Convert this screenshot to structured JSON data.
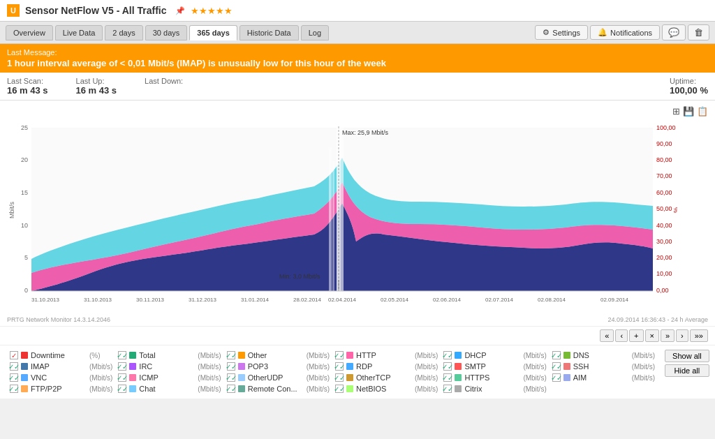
{
  "titleBar": {
    "icon": "U",
    "title": "Sensor NetFlow V5 - All Traffic",
    "stars": "★★★★★"
  },
  "navTabs": [
    {
      "label": "Overview",
      "active": false
    },
    {
      "label": "Live Data",
      "active": false
    },
    {
      "label": "2 days",
      "active": false
    },
    {
      "label": "30 days",
      "active": false
    },
    {
      "label": "365 days",
      "active": true
    },
    {
      "label": "Historic Data",
      "active": false
    },
    {
      "label": "Log",
      "active": false
    }
  ],
  "navActions": [
    {
      "label": "Settings",
      "icon": "⚙"
    },
    {
      "label": "Notifications",
      "icon": "🔔"
    }
  ],
  "alert": {
    "title": "Last Message:",
    "message": "1 hour interval average of < 0,01 Mbit/s (IMAP) is unusually low for this hour of the week"
  },
  "stats": [
    {
      "label": "Last Scan:",
      "value": "16 m 43 s"
    },
    {
      "label": "Last Up:",
      "value": "16 m 43 s"
    },
    {
      "label": "Last Down:",
      "value": ""
    },
    {
      "label": "Uptime:",
      "value": "100,00 %"
    }
  ],
  "chart": {
    "maxLabel": "Max: 25,9 Mbit/s",
    "minLabel": "Min: 3,0 Mbit/s",
    "leftAxis": [
      "25",
      "20",
      "15",
      "10",
      "5",
      "0"
    ],
    "leftAxisLabel": "Mbit/s",
    "rightAxis": [
      "100,00",
      "90,00",
      "80,00",
      "70,00",
      "60,00",
      "50,00",
      "40,00",
      "30,00",
      "20,00",
      "10,00",
      "0,00"
    ],
    "rightAxisLabel": "%",
    "xLabels": [
      "31.10.2013",
      "31.10.2013",
      "30.11.2013",
      "31.12.2013",
      "31.01.2014",
      "28.02.2014",
      "02.04.2014",
      "02.05.2014",
      "02.06.2014",
      "02.07.2014",
      "02.08.2014",
      "02.09.2014"
    ],
    "footerLeft": "PRTG Network Monitor 14.3.14.2046",
    "footerRight": "24.09.2014 16:36:43 - 24 h Average"
  },
  "navArrows": [
    "«",
    "‹",
    "+",
    "×",
    "»",
    "›",
    "»»"
  ],
  "legend": {
    "columns": [
      [
        {
          "checked": true,
          "checkColor": "red",
          "dot": "#e33",
          "name": "Downtime",
          "unit": "(%)"
        },
        {
          "checked": true,
          "checkColor": "blue",
          "dot": "#47a",
          "name": "IMAP",
          "unit": "(Mbit/s)"
        },
        {
          "checked": true,
          "checkColor": "blue",
          "dot": "#5af",
          "name": "VNC",
          "unit": "(Mbit/s)"
        },
        {
          "checked": true,
          "checkColor": "blue",
          "dot": "#fa5",
          "name": "FTP/P2P",
          "unit": "(Mbit/s)"
        }
      ],
      [
        {
          "checked": true,
          "checkColor": "blue",
          "dot": "#2a7",
          "name": "Total",
          "unit": "(Mbit/s)"
        },
        {
          "checked": true,
          "checkColor": "blue",
          "dot": "#a5f",
          "name": "IRC",
          "unit": "(Mbit/s)"
        },
        {
          "checked": true,
          "checkColor": "blue",
          "dot": "#f7a",
          "name": "ICMP",
          "unit": "(Mbit/s)"
        },
        {
          "checked": true,
          "checkColor": "blue",
          "dot": "#7cf",
          "name": "Chat",
          "unit": "(Mbit/s)"
        }
      ],
      [
        {
          "checked": true,
          "checkColor": "blue",
          "dot": "#f90",
          "name": "Other",
          "unit": "(Mbit/s)"
        },
        {
          "checked": true,
          "checkColor": "blue",
          "dot": "#c7e",
          "name": "POP3",
          "unit": "(Mbit/s)"
        },
        {
          "checked": true,
          "checkColor": "blue",
          "dot": "#9cf",
          "name": "OtherUDP",
          "unit": "(Mbit/s)"
        },
        {
          "checked": true,
          "checkColor": "blue",
          "dot": "#6a9",
          "name": "Remote Con...",
          "unit": "(Mbit/s)"
        }
      ],
      [
        {
          "checked": true,
          "checkColor": "blue",
          "dot": "#f6a",
          "name": "HTTP",
          "unit": "(Mbit/s)"
        },
        {
          "checked": true,
          "checkColor": "blue",
          "dot": "#4af",
          "name": "RDP",
          "unit": "(Mbit/s)"
        },
        {
          "checked": true,
          "checkColor": "blue",
          "dot": "#c93",
          "name": "OtherTCP",
          "unit": "(Mbit/s)"
        },
        {
          "checked": true,
          "checkColor": "blue",
          "dot": "#af7",
          "name": "NetBIOS",
          "unit": "(Mbit/s)"
        }
      ],
      [
        {
          "checked": true,
          "checkColor": "blue",
          "dot": "#3af",
          "name": "DHCP",
          "unit": "(Mbit/s)"
        },
        {
          "checked": true,
          "checkColor": "blue",
          "dot": "#f55",
          "name": "SMTP",
          "unit": "(Mbit/s)"
        },
        {
          "checked": true,
          "checkColor": "blue",
          "dot": "#5c9",
          "name": "HTTPS",
          "unit": "(Mbit/s)"
        },
        {
          "checked": true,
          "checkColor": "blue",
          "dot": "#aaa",
          "name": "Citrix",
          "unit": "(Mbit/s)"
        }
      ],
      [
        {
          "checked": true,
          "checkColor": "blue",
          "dot": "#7b3",
          "name": "DNS",
          "unit": "(Mbit/s)"
        },
        {
          "checked": true,
          "checkColor": "blue",
          "dot": "#e77",
          "name": "SSH",
          "unit": "(Mbit/s)"
        },
        {
          "checked": true,
          "checkColor": "blue",
          "dot": "#9ae",
          "name": "AIM",
          "unit": "(Mbit/s)"
        },
        {
          "checked": false,
          "checkColor": "none",
          "dot": "#fff",
          "name": "",
          "unit": ""
        }
      ]
    ],
    "showAll": "Show all",
    "hideAll": "Hide all"
  }
}
